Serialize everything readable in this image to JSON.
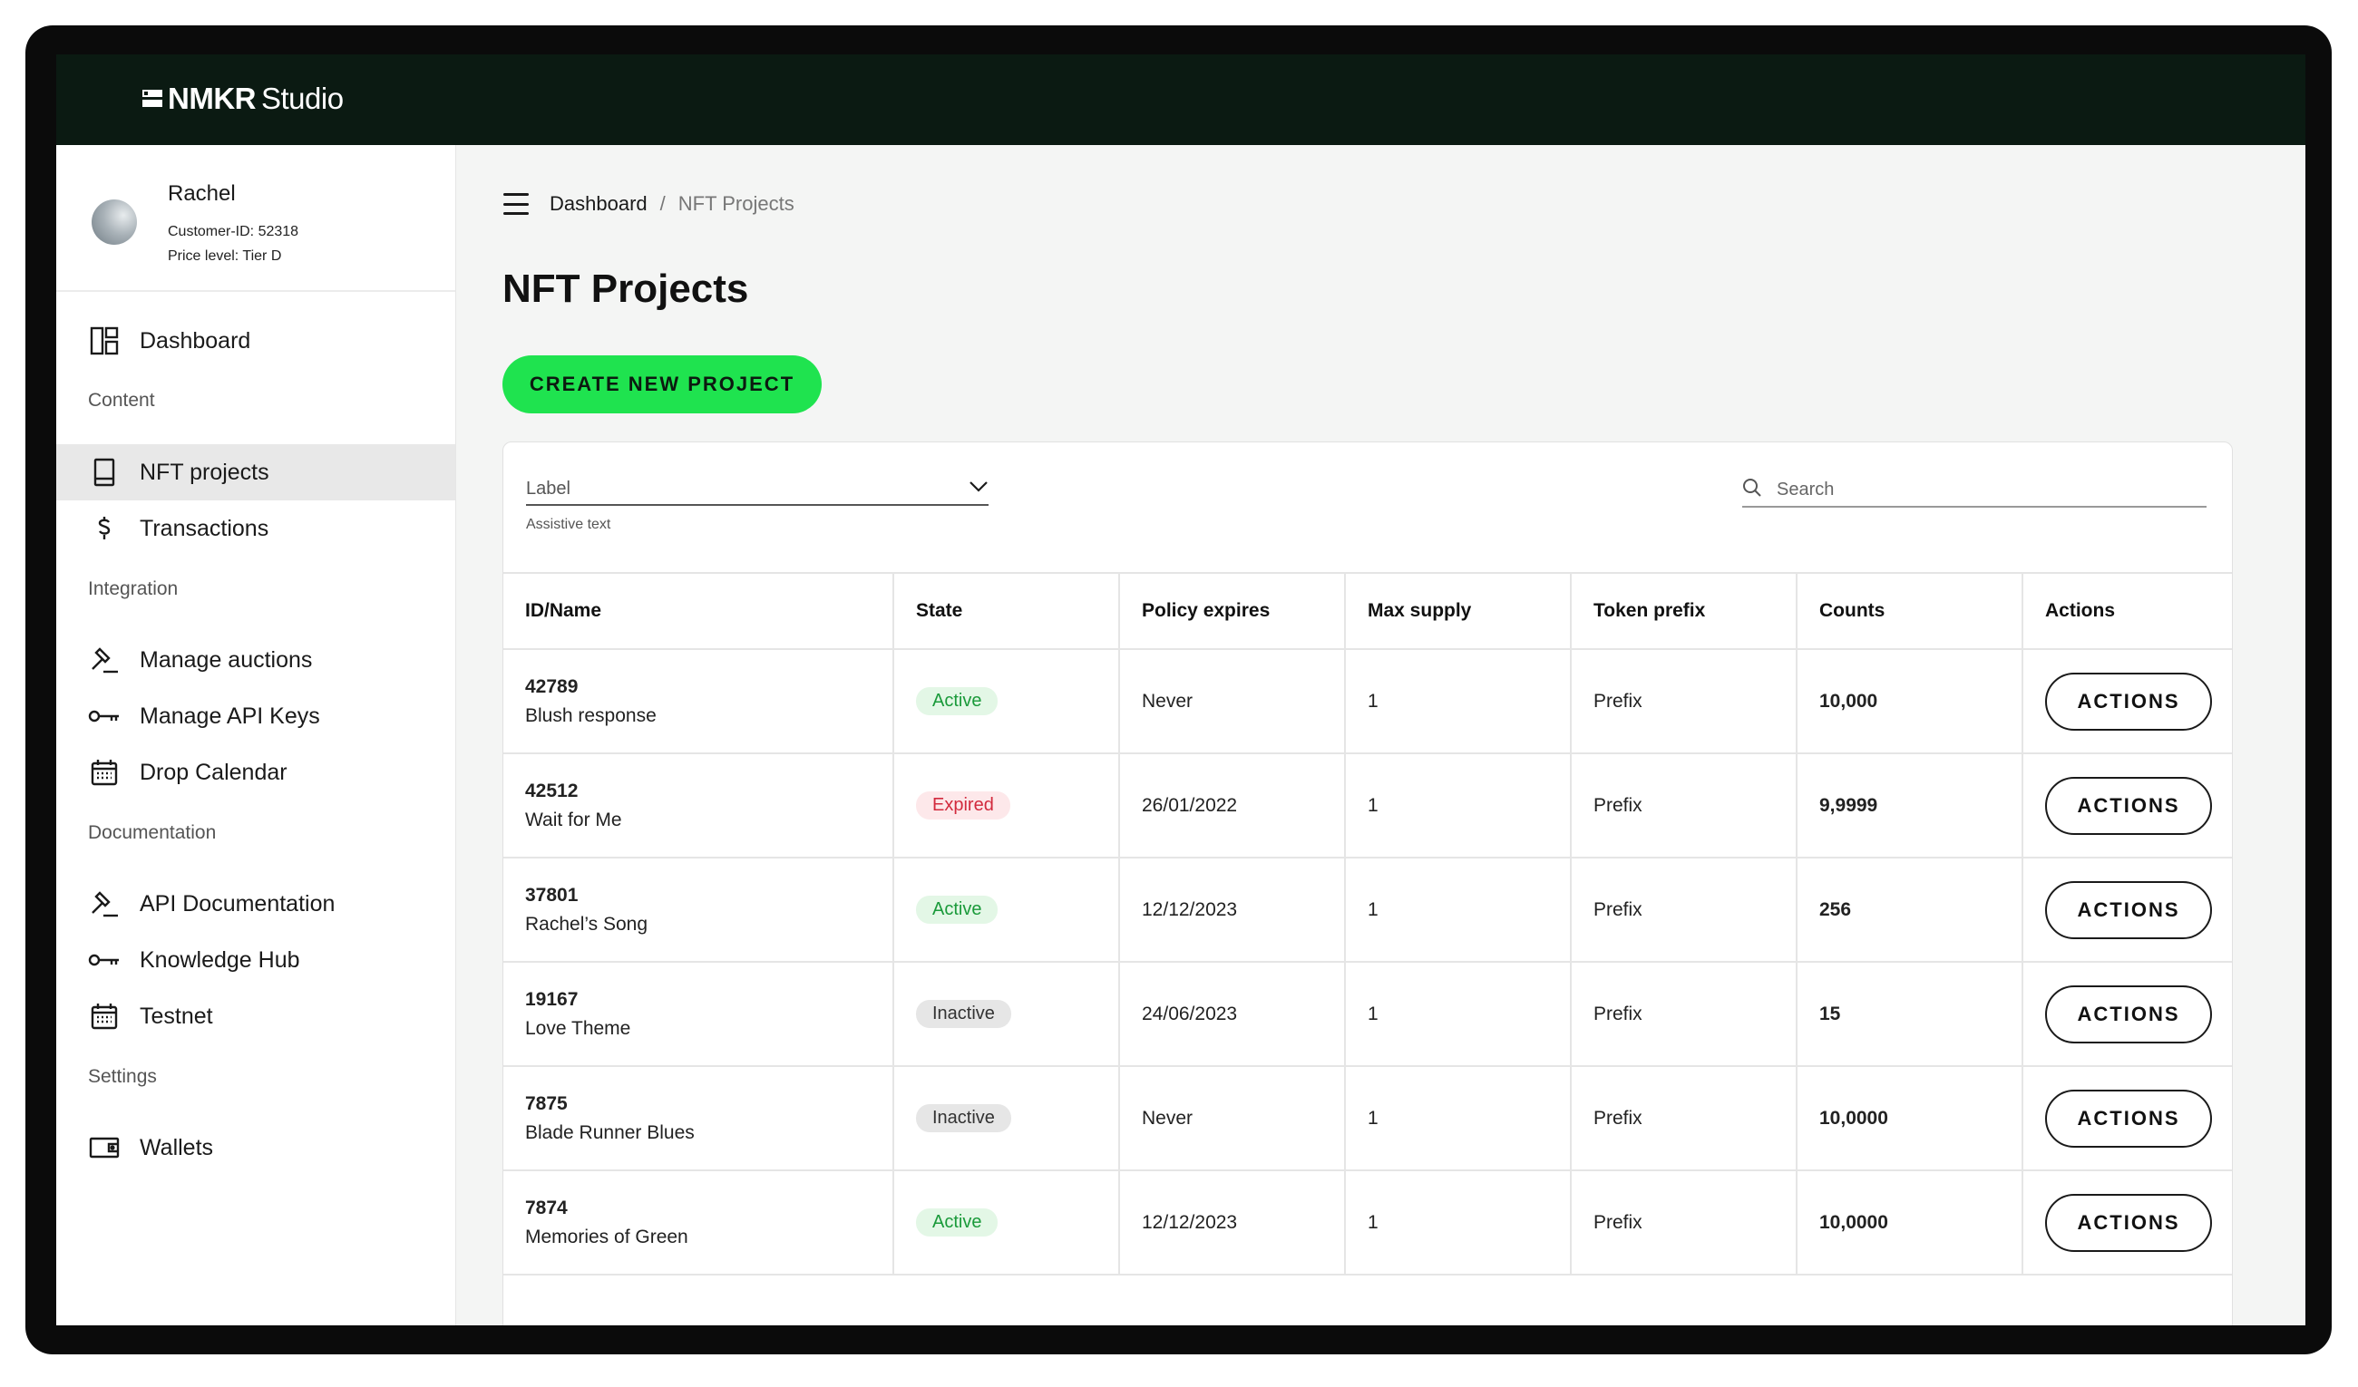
{
  "app": {
    "logo_brand": "NMKR",
    "logo_product": "Studio"
  },
  "user": {
    "name": "Rachel",
    "customer_id": "Customer-ID: 52318",
    "price_level": "Price level: Tier D"
  },
  "sidebar": {
    "dashboard": "Dashboard",
    "sections": {
      "content": "Content",
      "integration": "Integration",
      "documentation": "Documentation",
      "settings": "Settings"
    },
    "items": {
      "nft_projects": "NFT projects",
      "transactions": "Transactions",
      "manage_auctions": "Manage auctions",
      "manage_api_keys": "Manage API Keys",
      "drop_calendar": "Drop Calendar",
      "api_documentation": "API Documentation",
      "knowledge_hub": "Knowledge Hub",
      "testnet": "Testnet",
      "wallets": "Wallets"
    }
  },
  "breadcrumb": {
    "home": "Dashboard",
    "separator": "/",
    "current": "NFT Projects"
  },
  "page": {
    "title": "NFT Projects",
    "create_button": "CREATE NEW PROJECT"
  },
  "filters": {
    "label_select": "Label",
    "assistive_text": "Assistive text",
    "search_placeholder": "Search"
  },
  "table": {
    "headers": [
      "ID/Name",
      "State",
      "Policy expires",
      "Max supply",
      "Token prefix",
      "Counts",
      "Actions"
    ],
    "action_label": "ACTIONS",
    "rows": [
      {
        "id": "42789",
        "name": "Blush response",
        "state": "Active",
        "state_kind": "active",
        "policy": "Never",
        "max_supply": "1",
        "prefix": "Prefix",
        "counts": "10,000"
      },
      {
        "id": "42512",
        "name": "Wait for Me",
        "state": "Expired",
        "state_kind": "expired",
        "policy": "26/01/2022",
        "max_supply": "1",
        "prefix": "Prefix",
        "counts": "9,9999"
      },
      {
        "id": "37801",
        "name": "Rachel’s Song",
        "state": "Active",
        "state_kind": "active",
        "policy": "12/12/2023",
        "max_supply": "1",
        "prefix": "Prefix",
        "counts": "256"
      },
      {
        "id": "19167",
        "name": "Love Theme",
        "state": "Inactive",
        "state_kind": "inactive",
        "policy": "24/06/2023",
        "max_supply": "1",
        "prefix": "Prefix",
        "counts": "15"
      },
      {
        "id": "7875",
        "name": "Blade Runner Blues",
        "state": "Inactive",
        "state_kind": "inactive",
        "policy": "Never",
        "max_supply": "1",
        "prefix": "Prefix",
        "counts": "10,0000"
      },
      {
        "id": "7874",
        "name": "Memories of Green",
        "state": "Active",
        "state_kind": "active",
        "policy": "12/12/2023",
        "max_supply": "1",
        "prefix": "Prefix",
        "counts": "10,0000"
      }
    ]
  },
  "colors": {
    "topbar": "#0b1a12",
    "accent_green": "#1fe34f",
    "active_badge": "#1a9a3a",
    "expired_badge": "#d22a3d"
  }
}
